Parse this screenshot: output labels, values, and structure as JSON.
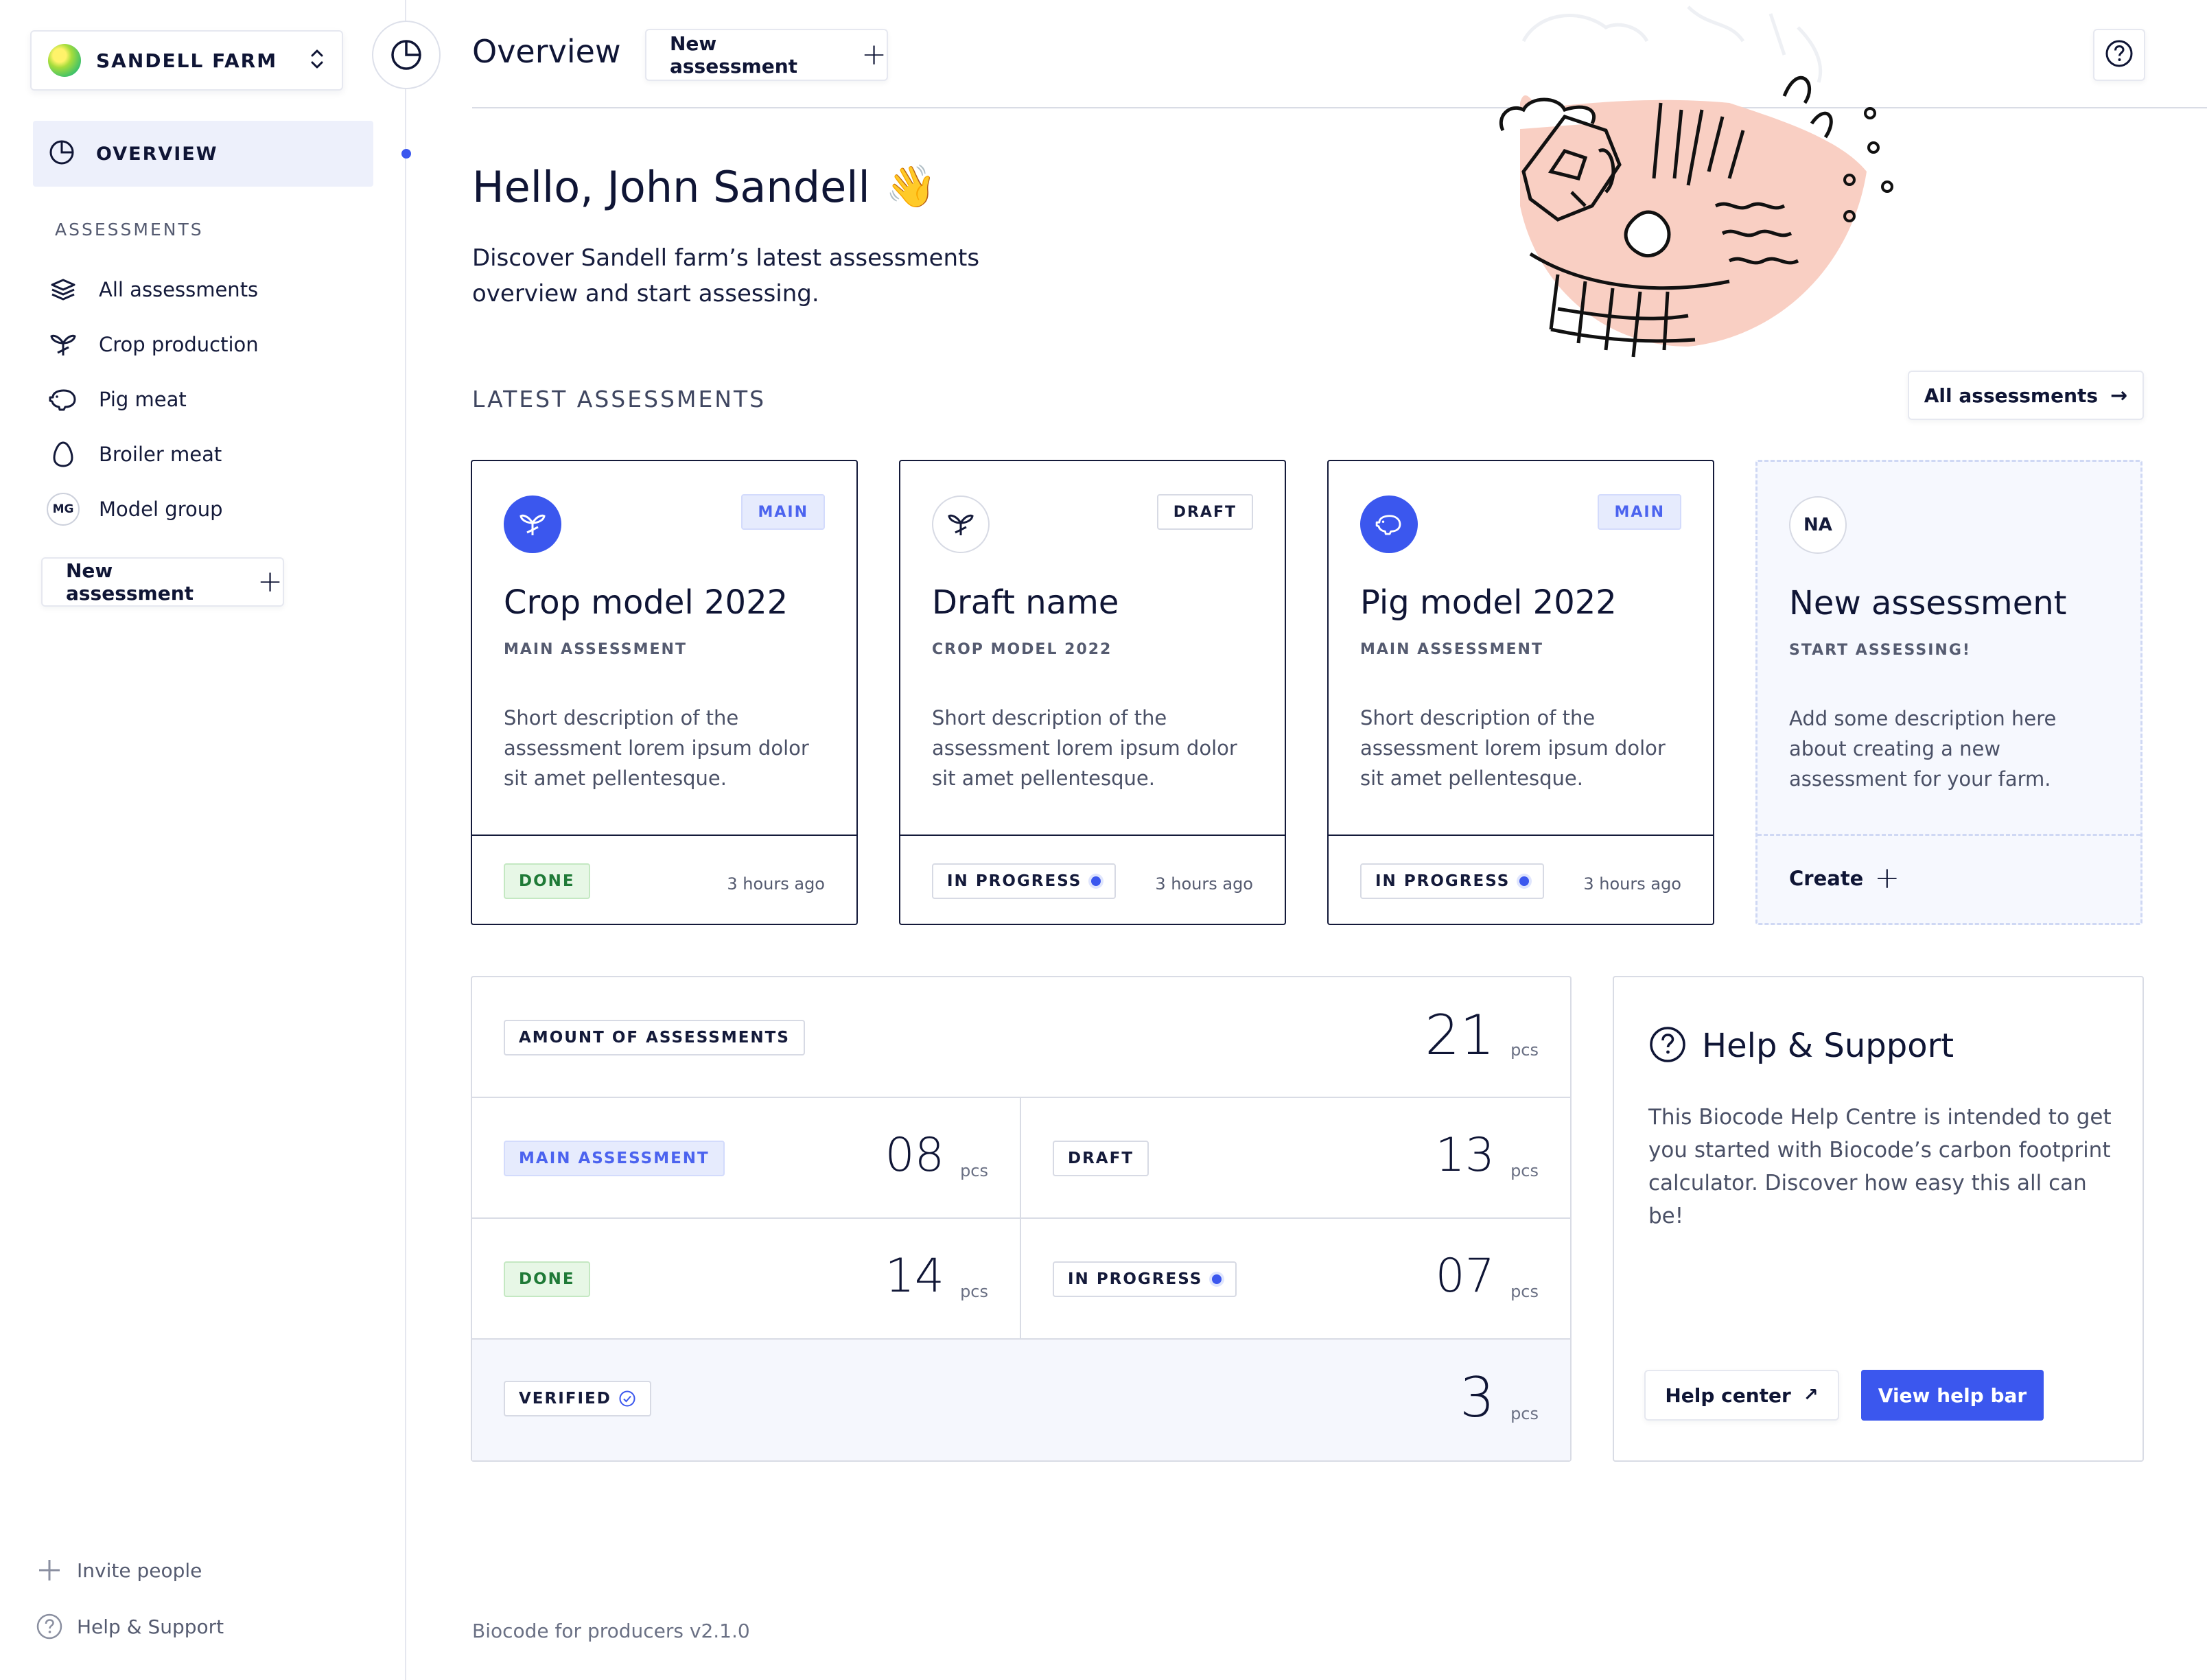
{
  "colors": {
    "accent": "#3b57ee",
    "ink": "#0f1535",
    "done_green": "#1f7a37",
    "illustration_pink": "#f9cfc3"
  },
  "sidebar": {
    "farm_name": "SANDELL FARM",
    "overview_label": "OVERVIEW",
    "assessments_heading": "ASSESSMENTS",
    "items": [
      {
        "label": "All assessments",
        "icon": "layers-icon"
      },
      {
        "label": "Crop production",
        "icon": "sprout-icon"
      },
      {
        "label": "Pig meat",
        "icon": "pig-icon"
      },
      {
        "label": "Broiler meat",
        "icon": "egg-icon"
      },
      {
        "label": "Model group",
        "icon": "mg-badge",
        "badge": "MG"
      }
    ],
    "new_assessment_label": "New assessment",
    "invite_label": "Invite people",
    "help_label": "Help & Support"
  },
  "header": {
    "title": "Overview",
    "new_assessment_label": "New assessment"
  },
  "hero": {
    "greeting": "Hello, John Sandell",
    "emoji": "👋",
    "intro": "Discover Sandell farm’s latest assessments overview and start assessing."
  },
  "latest": {
    "heading": "LATEST ASSESSMENTS",
    "all_button": "All assessments",
    "cards": [
      {
        "title": "Crop model 2022",
        "subtitle": "MAIN ASSESSMENT",
        "tag": "MAIN",
        "description": "Short description of the assessment lorem ipsum dolor sit amet pellentesque.",
        "status": "DONE",
        "time": "3 hours ago",
        "icon": "sprout-icon"
      },
      {
        "title": "Draft name",
        "subtitle": "CROP MODEL 2022",
        "tag": "DRAFT",
        "description": "Short description of the assessment lorem ipsum dolor sit amet pellentesque.",
        "status": "IN PROGRESS",
        "time": "3 hours ago",
        "icon": "sprout-icon"
      },
      {
        "title": "Pig model 2022",
        "subtitle": "MAIN ASSESSMENT",
        "tag": "MAIN",
        "description": "Short description of the assessment lorem ipsum dolor sit amet pellentesque.",
        "status": "IN PROGRESS",
        "time": "3 hours ago",
        "icon": "pig-icon"
      }
    ],
    "new_card": {
      "badge": "NA",
      "title": "New assessment",
      "subtitle": "START ASSESSING!",
      "description": "Add some description here about creating a new assessment for your farm.",
      "create_label": "Create"
    }
  },
  "stats": {
    "unit": "pcs",
    "total": {
      "label": "AMOUNT OF ASSESSMENTS",
      "value": "21"
    },
    "main": {
      "label": "MAIN ASSESSMENT",
      "value": "08"
    },
    "draft": {
      "label": "DRAFT",
      "value": "13"
    },
    "done": {
      "label": "DONE",
      "value": "14"
    },
    "in_progress": {
      "label": "IN PROGRESS",
      "value": "07"
    },
    "verified": {
      "label": "VERIFIED",
      "value": "3"
    }
  },
  "help": {
    "title": "Help & Support",
    "body": "This Biocode Help Centre is intended to get you started with Biocode’s carbon footprint calculator. Discover how easy this all can be!",
    "help_center_label": "Help center",
    "view_help_bar_label": "View help bar"
  },
  "footer": {
    "version": "Biocode for producers v2.1.0"
  }
}
